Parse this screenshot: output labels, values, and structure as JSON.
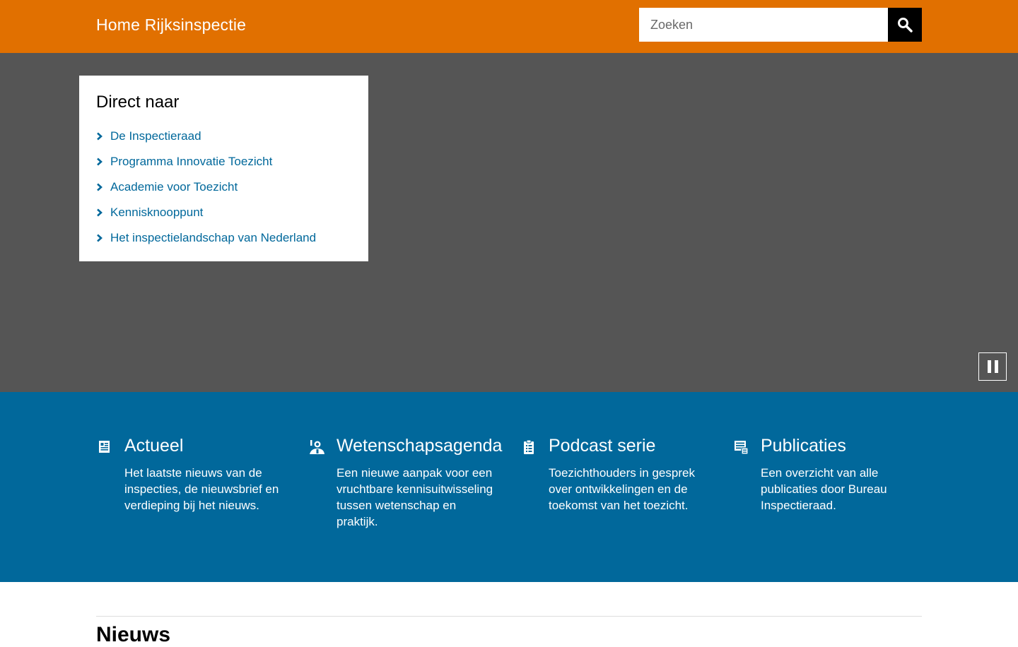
{
  "header": {
    "site_title": "Home Rijksinspectie",
    "search": {
      "placeholder": "Zoeken",
      "button_icon": "search-icon"
    },
    "colors": {
      "background": "#e17000"
    }
  },
  "hero": {
    "direct_naar": {
      "heading": "Direct naar",
      "links": [
        {
          "label": "De Inspectieraad"
        },
        {
          "label": "Programma Innovatie Toezicht"
        },
        {
          "label": "Academie voor Toezicht"
        },
        {
          "label": "Kennisknooppunt"
        },
        {
          "label": "Het inspectielandschap van Nederland"
        }
      ]
    },
    "pause_icon": "pause-icon",
    "colors": {
      "background": "#555555"
    }
  },
  "tiles": [
    {
      "icon": "newspaper-icon",
      "title": "Actueel",
      "text": "Het laatste nieuws van de inspecties, de nieuwsbrief en verdieping bij het nieuws."
    },
    {
      "icon": "scientist-icon",
      "title": "Wetenschapsagenda",
      "text": "Een nieuwe aanpak voor een vruchtbare kennisuitwisseling tussen wetenschap en praktijk."
    },
    {
      "icon": "clipboard-icon",
      "title": "Podcast serie",
      "text": "Toezichthouders in gesprek over ontwikkelingen en de toekomst van het toezicht."
    },
    {
      "icon": "publications-icon",
      "title": "Publicaties",
      "text": "Een overzicht van alle publicaties door Bureau Inspectieraad."
    }
  ],
  "band_colors": {
    "background": "#01689b"
  },
  "news": {
    "heading": "Nieuws"
  }
}
